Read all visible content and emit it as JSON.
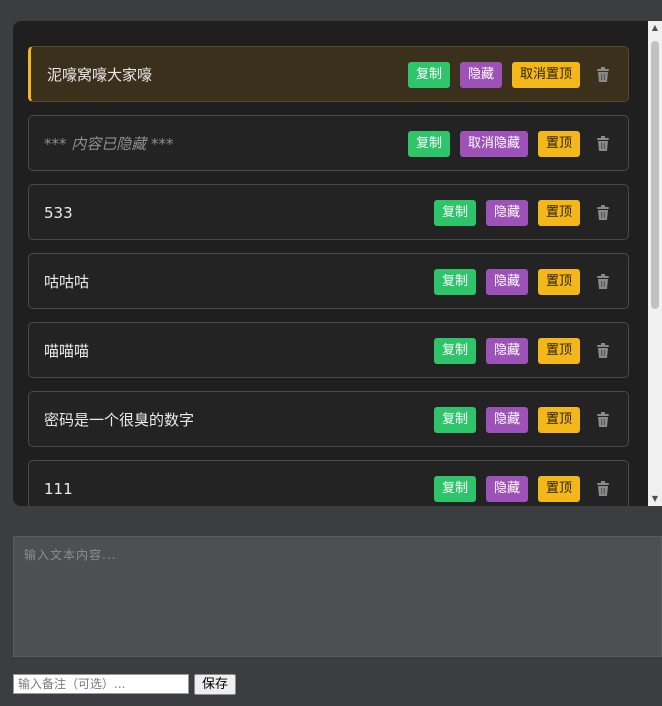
{
  "items": [
    {
      "text": "泥嚎窝嚎大家嚎",
      "pinned": true,
      "hidden": false,
      "copy_label": "复制",
      "hide_label": "隐藏",
      "pin_label": "取消置顶"
    },
    {
      "text": "*** 内容已隐藏 ***",
      "pinned": false,
      "hidden": true,
      "copy_label": "复制",
      "hide_label": "取消隐藏",
      "pin_label": "置顶"
    },
    {
      "text": "533",
      "pinned": false,
      "hidden": false,
      "copy_label": "复制",
      "hide_label": "隐藏",
      "pin_label": "置顶"
    },
    {
      "text": "咕咕咕",
      "pinned": false,
      "hidden": false,
      "copy_label": "复制",
      "hide_label": "隐藏",
      "pin_label": "置顶"
    },
    {
      "text": "喵喵喵",
      "pinned": false,
      "hidden": false,
      "copy_label": "复制",
      "hide_label": "隐藏",
      "pin_label": "置顶"
    },
    {
      "text": "密码是一个很臭的数字",
      "pinned": false,
      "hidden": false,
      "copy_label": "复制",
      "hide_label": "隐藏",
      "pin_label": "置顶"
    },
    {
      "text": "111",
      "pinned": false,
      "hidden": false,
      "copy_label": "复制",
      "hide_label": "隐藏",
      "pin_label": "置顶"
    }
  ],
  "icons": {
    "delete": "trash-icon"
  },
  "colors": {
    "copy": "#2ec56a",
    "hide": "#9c52b6",
    "pin": "#f3b71a",
    "pinned_bg": "#3b301b"
  },
  "editor": {
    "placeholder": "输入文本内容..."
  },
  "note": {
    "placeholder": "输入备注（可选）..."
  },
  "save_label": "保存"
}
